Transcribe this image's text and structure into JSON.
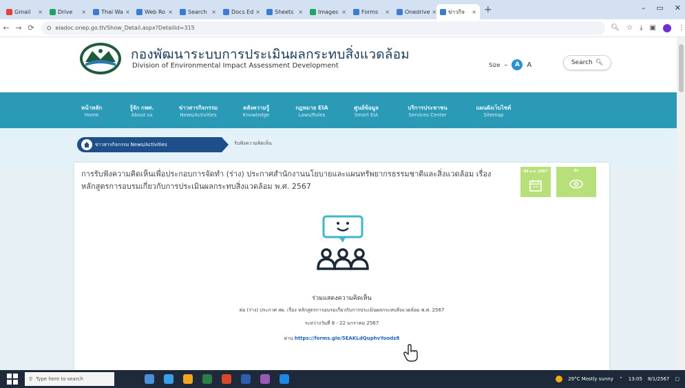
{
  "browser": {
    "tabs": [
      {
        "label": "Gmail",
        "color": "#db4437"
      },
      {
        "label": "Drive",
        "color": "#1fa463"
      },
      {
        "label": "Thai Wa",
        "color": "#3b7bd4"
      },
      {
        "label": "Web Ro",
        "color": "#3b7bd4"
      },
      {
        "label": "Search",
        "color": "#3b7bd4"
      },
      {
        "label": "Docs Ed",
        "color": "#3b7bd4"
      },
      {
        "label": "Sheets",
        "color": "#3b7bd4"
      },
      {
        "label": "Images",
        "color": "#1fa463"
      },
      {
        "label": "Forms",
        "color": "#3b7bd4"
      },
      {
        "label": "Onedrive",
        "color": "#3b7bd4"
      },
      {
        "label": "ข่าวกิจ",
        "color": "#3b7bd4"
      }
    ],
    "new_tab": "+",
    "window_controls": {
      "minimize": "–",
      "maximize": "▭",
      "close": "✕"
    },
    "url": "eiadoc.onep.go.th/Show_Detail.aspx?Detailid=315"
  },
  "site": {
    "title_th": "กองพัฒนาระบบการประเมินผลกระทบสิ่งแวดล้อม",
    "title_en": "Division of Environmental Impact Assessment Development",
    "size_label": "Size",
    "size_minus": "–",
    "size_default": "A",
    "size_plus": "A",
    "search_label": "Search"
  },
  "nav": [
    {
      "th": "หน้าหลัก",
      "en": "Home"
    },
    {
      "th": "รู้จัก กพศ.",
      "en": "About us"
    },
    {
      "th": "ข่าวสารกิจกรรม",
      "en": "News/Activities"
    },
    {
      "th": "คลังความรู้",
      "en": "Knowledge"
    },
    {
      "th": "กฎหมาย EIA",
      "en": "Laws/Rules"
    },
    {
      "th": "ศูนย์ข้อมูล",
      "en": "Smart EIA"
    },
    {
      "th": "บริการประชาชน",
      "en": "Services Center"
    },
    {
      "th": "แผนผังเว็บไซต์",
      "en": "Sitemap"
    }
  ],
  "breadcrumb": {
    "section": "ข่าวสารกิจกรรม News/Activities",
    "current": "รับฟังความคิดเห็น"
  },
  "post": {
    "title": "การรับฟังความคิดเห็นเพื่อประกอบการจัดทำ (ร่าง) ประกาศสำนักงานนโยบายและแผนทรัพยากรธรรมชาติและสิ่งแวดล้อม เรื่องหลักสูตรการอบรมเกี่ยวกับการประเมินผลกระทบสิ่งแวดล้อม พ.ศ. 2567",
    "date_label": "08 ม.ค. 2567",
    "views_label": "81",
    "join_title": "ร่วมแสดงความคิดเห็น",
    "desc": "ต่อ (ร่าง) ประกาศ สผ. เรื่อง หลักสูตรการอบรมเกี่ยวกับการประเมินผลกระทบสิ่งแวดล้อม พ.ศ. 2567",
    "period": "ระหว่างวันที่ 8 - 22 มกราคม 2567",
    "link_prefix": "ผ่าน",
    "link_url": "https://forms.gle/5EAKLdQuphvYoodz8"
  },
  "taskbar": {
    "search_placeholder": "Type here to search",
    "weather": "29°C Mostly sunny",
    "time": "13:05",
    "date": "8/1/2567",
    "app_colors": [
      "#4a90d9",
      "#3aa0e8",
      "#f4a623",
      "#2d7d46",
      "#d9482b",
      "#2b5fb4",
      "#9b59b6",
      "#1e88e5"
    ]
  }
}
